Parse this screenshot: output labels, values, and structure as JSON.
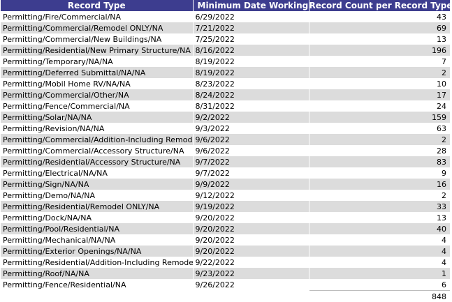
{
  "columns": {
    "record_type": "Record Type",
    "min_date": "Minimum Date Working",
    "count": "Record Count per Record Type"
  },
  "sort_indicator": "▲",
  "rows": [
    {
      "type": "Permitting/Fire/Commercial/NA",
      "date": "6/29/2022",
      "count": "43"
    },
    {
      "type": "Permitting/Commercial/Remodel ONLY/NA",
      "date": "7/21/2022",
      "count": "69"
    },
    {
      "type": "Permitting/Commercial/New Buildings/NA",
      "date": "7/25/2022",
      "count": "13"
    },
    {
      "type": "Permitting/Residential/New Primary Structure/NA",
      "date": "8/16/2022",
      "count": "196"
    },
    {
      "type": "Permitting/Temporary/NA/NA",
      "date": "8/19/2022",
      "count": "7"
    },
    {
      "type": "Permitting/Deferred Submittal/NA/NA",
      "date": "8/19/2022",
      "count": "2"
    },
    {
      "type": "Permitting/Mobil Home RV/NA/NA",
      "date": "8/23/2022",
      "count": "10"
    },
    {
      "type": "Permitting/Commercial/Other/NA",
      "date": "8/24/2022",
      "count": "17"
    },
    {
      "type": "Permitting/Fence/Commercial/NA",
      "date": "8/31/2022",
      "count": "24"
    },
    {
      "type": "Permitting/Solar/NA/NA",
      "date": "9/2/2022",
      "count": "159"
    },
    {
      "type": "Permitting/Revision/NA/NA",
      "date": "9/3/2022",
      "count": "63"
    },
    {
      "type": "Permitting/Commercial/Addition-Including Remodeling/NA",
      "date": "9/6/2022",
      "count": "2"
    },
    {
      "type": "Permitting/Commercial/Accessory Structure/NA",
      "date": "9/6/2022",
      "count": "28"
    },
    {
      "type": "Permitting/Residential/Accessory Structure/NA",
      "date": "9/7/2022",
      "count": "83"
    },
    {
      "type": "Permitting/Electrical/NA/NA",
      "date": "9/7/2022",
      "count": "9"
    },
    {
      "type": "Permitting/Sign/NA/NA",
      "date": "9/9/2022",
      "count": "16"
    },
    {
      "type": "Permitting/Demo/NA/NA",
      "date": "9/12/2022",
      "count": "2"
    },
    {
      "type": "Permitting/Residential/Remodel ONLY/NA",
      "date": "9/19/2022",
      "count": "33"
    },
    {
      "type": "Permitting/Dock/NA/NA",
      "date": "9/20/2022",
      "count": "13"
    },
    {
      "type": "Permitting/Pool/Residential/NA",
      "date": "9/20/2022",
      "count": "40"
    },
    {
      "type": "Permitting/Mechanical/NA/NA",
      "date": "9/20/2022",
      "count": "4"
    },
    {
      "type": "Permitting/Exterior Openings/NA/NA",
      "date": "9/20/2022",
      "count": "4"
    },
    {
      "type": "Permitting/Residential/Addition-Including Remodeling/NA",
      "date": "9/22/2022",
      "count": "4"
    },
    {
      "type": "Permitting/Roof/NA/NA",
      "date": "9/23/2022",
      "count": "1"
    },
    {
      "type": "Permitting/Fence/Residential/NA",
      "date": "9/26/2022",
      "count": "6"
    }
  ],
  "total": "848",
  "colors": {
    "header_bg": "#3d3d8f",
    "header_text": "#ffffff",
    "row_alt_bg": "#dcdcdc",
    "row_bg": "#ffffff"
  }
}
